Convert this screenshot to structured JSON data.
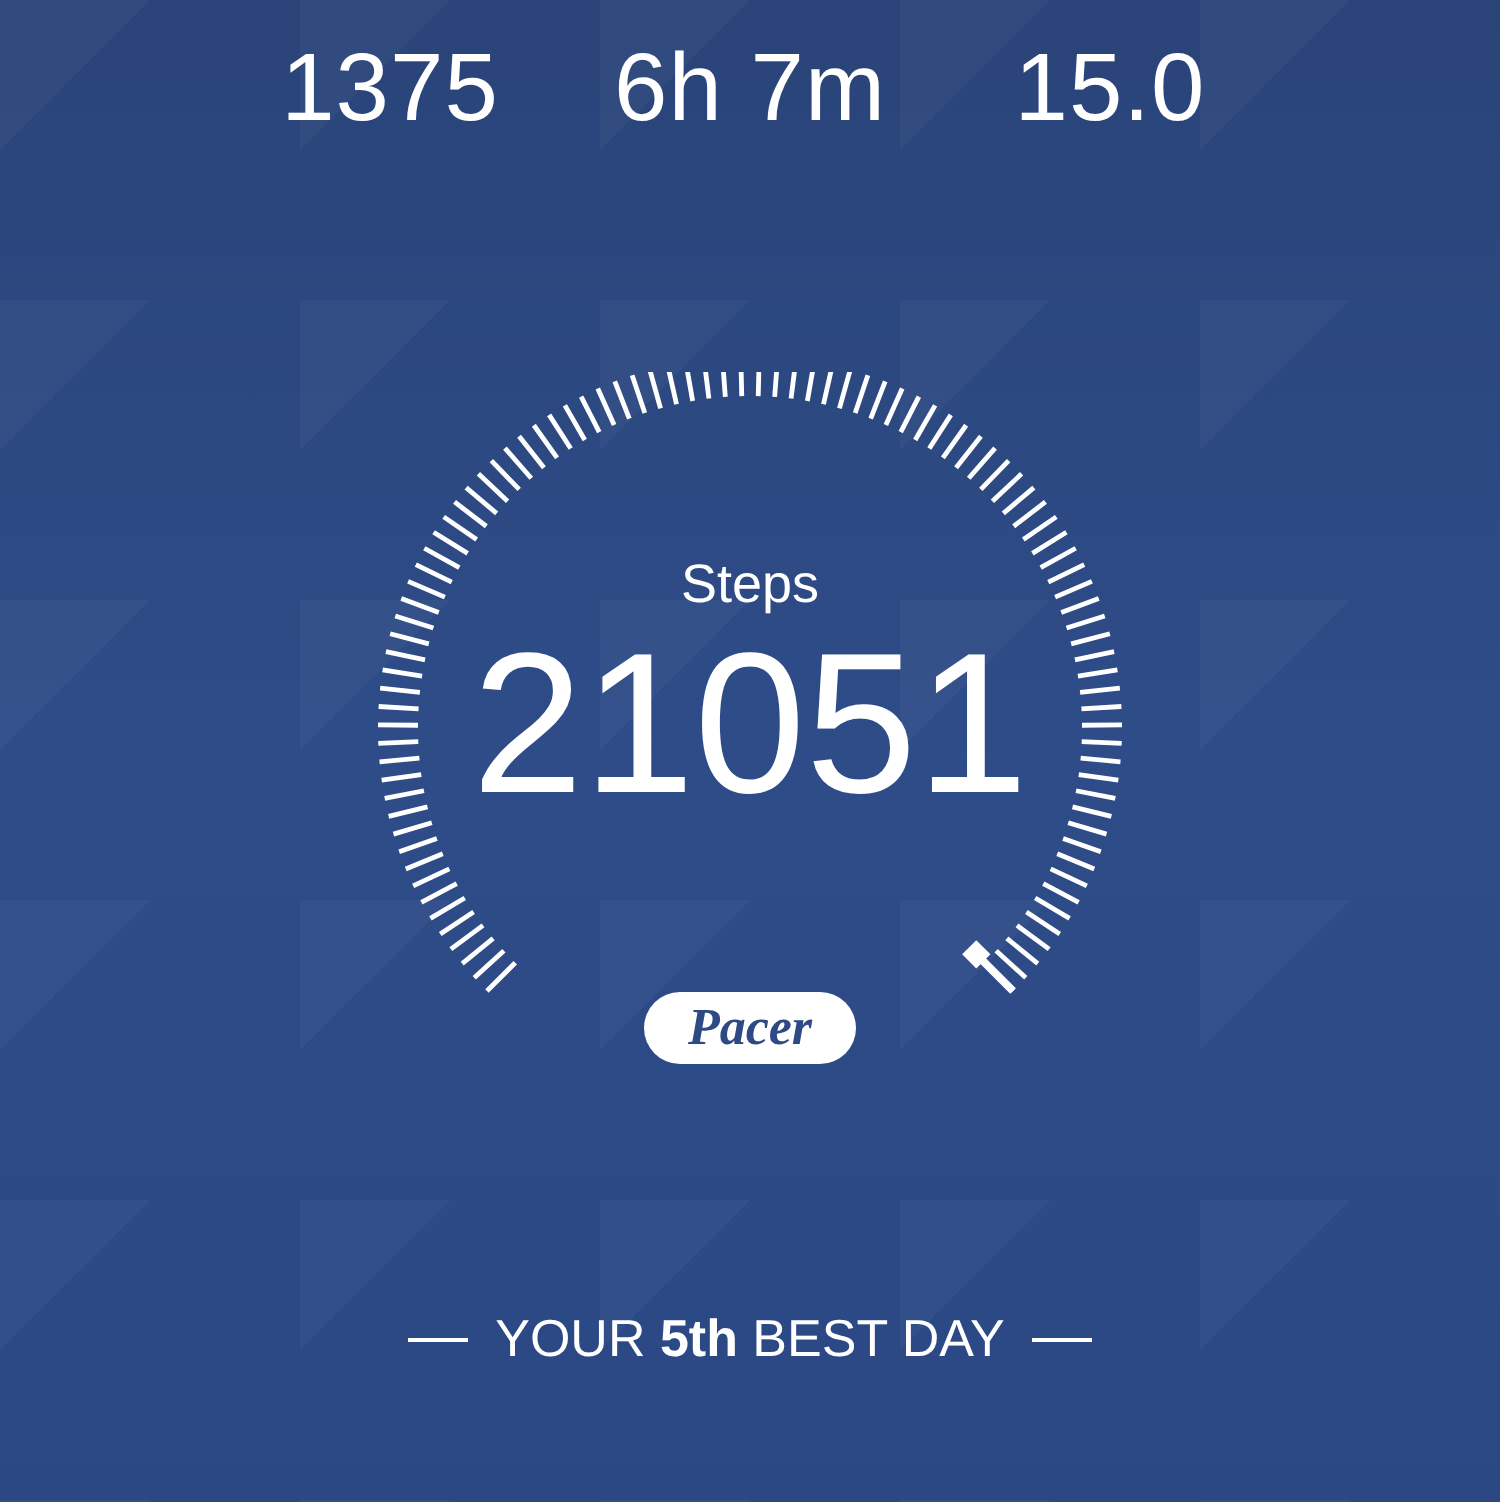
{
  "stats": [
    {
      "value": "1375"
    },
    {
      "value": "6h 7m"
    },
    {
      "value": "15.0"
    }
  ],
  "gauge": {
    "title": "Steps",
    "value": "21051"
  },
  "badge": "Pacer",
  "footer": "YOUR **5th** BEST DAY"
}
